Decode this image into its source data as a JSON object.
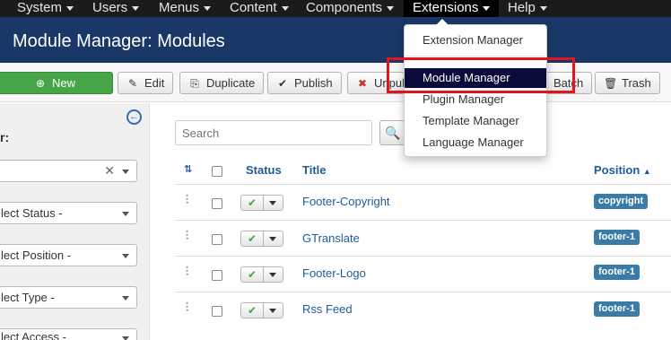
{
  "topnav": {
    "items": [
      {
        "label": "System"
      },
      {
        "label": "Users"
      },
      {
        "label": "Menus"
      },
      {
        "label": "Content"
      },
      {
        "label": "Components"
      },
      {
        "label": "Extensions"
      },
      {
        "label": "Help"
      }
    ]
  },
  "header": {
    "title": "Module Manager: Modules"
  },
  "toolbar": {
    "new": "New",
    "edit": "Edit",
    "duplicate": "Duplicate",
    "publish": "Publish",
    "unpublish": "Unpub",
    "batch": "Batch",
    "trash": "Trash"
  },
  "sidebar": {
    "label": "r:",
    "filters": [
      {
        "value": ""
      },
      {
        "value": "lect Status -"
      },
      {
        "value": "lect Position -"
      },
      {
        "value": "lect Type -"
      },
      {
        "value": "lect Access -"
      }
    ]
  },
  "search": {
    "placeholder": "Search"
  },
  "table": {
    "headers": {
      "status": "Status",
      "title": "Title",
      "position": "Position"
    },
    "rows": [
      {
        "title": "Footer-Copyright",
        "position": "copyright"
      },
      {
        "title": "GTranslate",
        "position": "footer-1"
      },
      {
        "title": "Footer-Logo",
        "position": "footer-1"
      },
      {
        "title": "Rss Feed",
        "position": "footer-1"
      }
    ]
  },
  "extensions_menu": {
    "items": [
      {
        "label": "Extension Manager"
      },
      {
        "label": "Module Manager"
      },
      {
        "label": "Plugin Manager"
      },
      {
        "label": "Template Manager"
      },
      {
        "label": "Language Manager"
      }
    ]
  },
  "colors": {
    "nav_bg": "#1b1b1b",
    "header_bg": "#1a3867",
    "new_button": "#46a546",
    "link": "#1f5a99",
    "badge": "#3a7ca5",
    "highlight_box": "#e3141c",
    "menu_highlight": "#0b0b3b"
  }
}
